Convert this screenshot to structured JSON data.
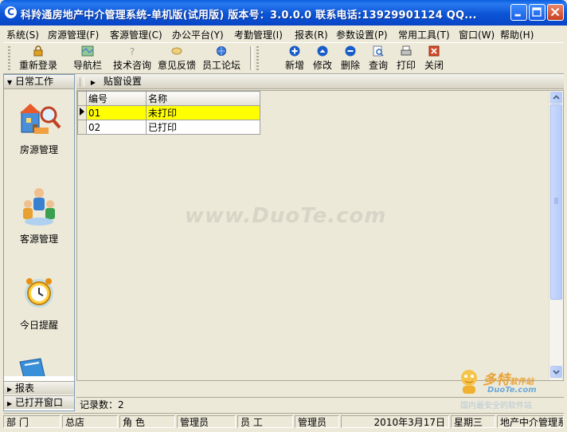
{
  "window": {
    "title": "科羚通房地产中介管理系统-单机版(试用版) 版本号：3.0.0.0 联系电话:13929901124 QQ..."
  },
  "menu": [
    "系统(S)",
    "房源管理(F)",
    "客源管理(C)",
    "办公平台(Y)",
    "考勤管理(I)",
    "报表(R)",
    "参数设置(P)",
    "常用工具(T)",
    "窗口(W)",
    "帮助(H)"
  ],
  "toolbar": {
    "left": [
      "重新登录",
      "导航栏",
      "技术咨询",
      "意见反馈",
      "员工论坛"
    ],
    "right": [
      "新增",
      "修改",
      "删除",
      "查询",
      "打印",
      "关闭"
    ]
  },
  "left_panel": {
    "header": "日常工作",
    "items": [
      "房源管理",
      "客源管理",
      "今日提醒"
    ],
    "footer": [
      "报表",
      "已打开窗口"
    ]
  },
  "right_panel": {
    "header": "贴窗设置",
    "columns": [
      "编号",
      "名称"
    ],
    "rows": [
      {
        "id": "01",
        "name": "未打印"
      },
      {
        "id": "02",
        "name": "已打印"
      }
    ],
    "record_count": "记录数：2"
  },
  "watermark": {
    "text": "www.DuoTe.com",
    "logo_line1": "多特",
    "logo_line1b": "软件站",
    "logo_line2": "DuoTe.com",
    "logo_line3": "国内最安全的软件站"
  },
  "statusbar": [
    "部  门",
    "总店",
    "角  色",
    "管理员",
    "员  工",
    "管理员",
    "2010年3月17日",
    "星期三",
    "地产中介管理系"
  ]
}
